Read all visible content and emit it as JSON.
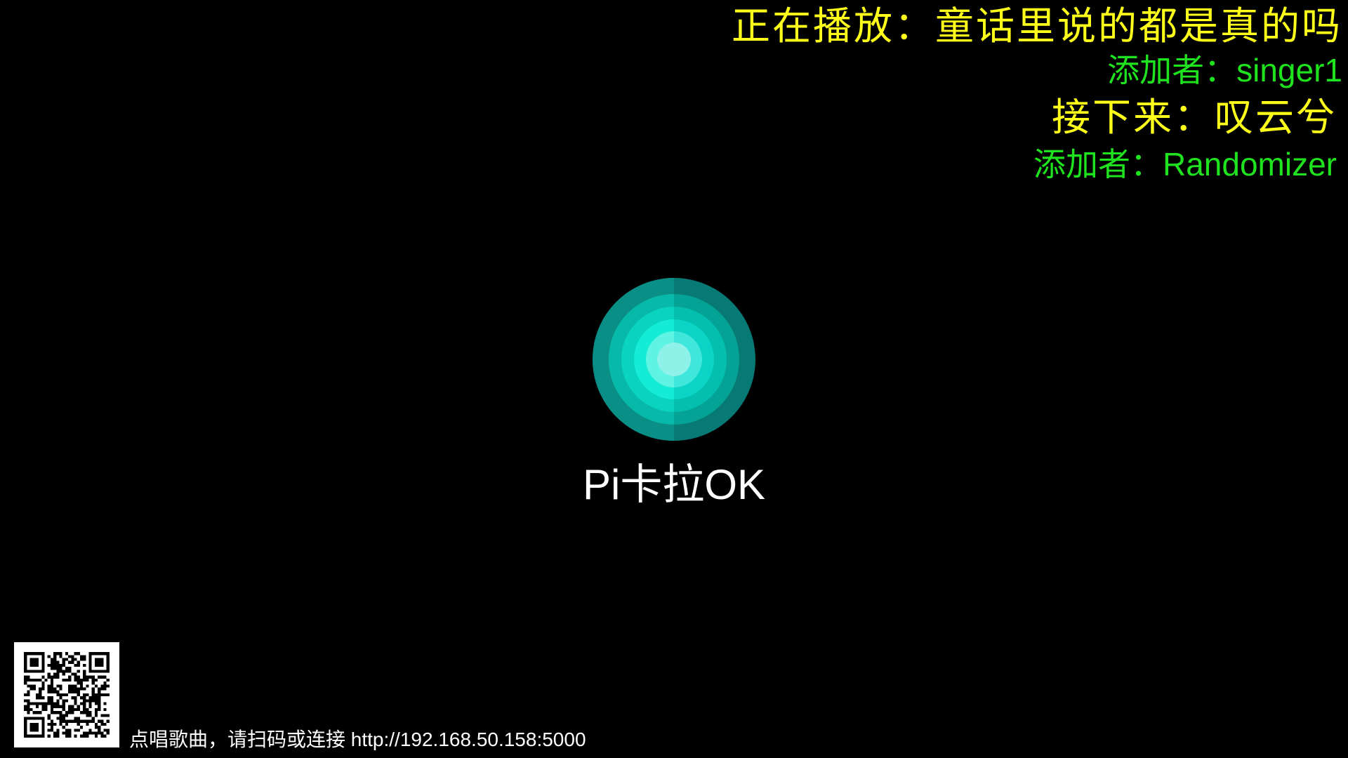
{
  "now_playing": {
    "prefix": "正在播放：",
    "title": "童话里说的都是真的吗",
    "added_by_prefix": "添加者：",
    "added_by": "singer1"
  },
  "up_next": {
    "prefix": "接下来：",
    "title": "叹云兮",
    "added_by_prefix": "添加者：",
    "added_by": "Randomizer"
  },
  "app": {
    "title": "Pi卡拉OK",
    "logo_icon": "concentric-circles-logo-icon"
  },
  "connect": {
    "hint": "点唱歌曲，请扫码或连接 http://192.168.50.158:5000",
    "qr_icon": "qr-code-icon"
  },
  "colors": {
    "background": "#000000",
    "song_text": "#ffff1a",
    "added_by_text": "#1ee31e",
    "app_title_text": "#ffffff",
    "logo_outer": "#077a75",
    "logo_mid": "#04b7a6",
    "logo_inner": "#12e7cf",
    "logo_core": "#8ff2e8"
  }
}
